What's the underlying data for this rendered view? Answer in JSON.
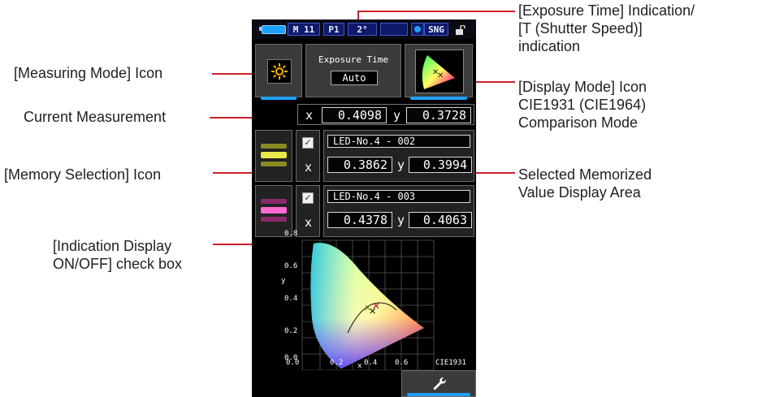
{
  "callouts": {
    "exposure_time_indication": "[Exposure Time] Indication/\n[T (Shutter Speed)]\nindication",
    "measuring_mode_icon": "[Measuring Mode] Icon",
    "display_mode_icon": "[Display Mode] Icon\nCIE1931 (CIE1964)\nComparison Mode",
    "current_measurement": "Current Measurement",
    "memory_selection_icon": "[Memory Selection] Icon",
    "selected_memorized_value": "Selected Memorized\nValue Display Area",
    "indication_display_checkbox": "[Indication Display\nON/OFF] check box"
  },
  "status_bar": {
    "mode": "M 11",
    "preset": "P1",
    "angle": "2°",
    "sng": "SNG"
  },
  "exposure": {
    "title": "Exposure Time",
    "value": "Auto"
  },
  "current": {
    "x_label": "x",
    "x_value": "0.4098",
    "y_label": "y",
    "y_value": "0.3728"
  },
  "memory": [
    {
      "name": "LED-No.4 - 002",
      "x_label": "x",
      "x_value": "0.3862",
      "y_label": "y",
      "y_value": "0.3994",
      "checked": "✓",
      "color": "#e8e84a"
    },
    {
      "name": "LED-No.4 - 003",
      "x_label": "x",
      "x_value": "0.4378",
      "y_label": "y",
      "y_value": "0.4063",
      "checked": "✓",
      "color": "#ff6ad0"
    }
  ],
  "diagram": {
    "y_label": "y",
    "x_label": "x",
    "y_ticks": [
      "0.8",
      "0.6",
      "0.4",
      "0.2",
      "0.0"
    ],
    "x_ticks": [
      "0.0",
      "0.2",
      "0.4",
      "0.6"
    ],
    "standard": "CIE1931"
  },
  "icons": {
    "measuring_mode": "sun-icon",
    "settings": "wrench-icon",
    "battery": "battery-icon",
    "lock": "lock-icon",
    "display_mode": "cie-triangle-icon"
  },
  "colors": {
    "callout_line": "#d0202a",
    "accent": "#1ea0ff",
    "status_bg": "#0f1a6b"
  }
}
